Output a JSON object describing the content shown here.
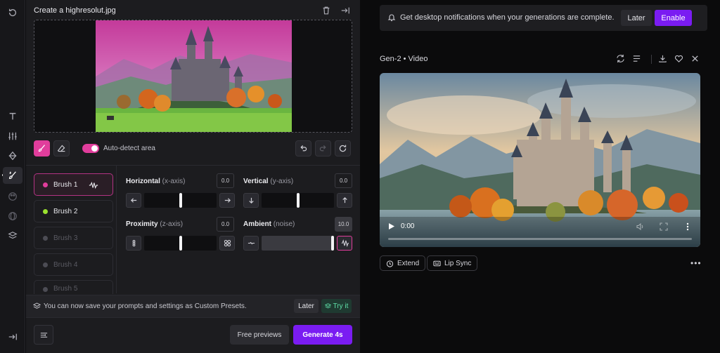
{
  "left_panel": {
    "title": "Create a highresolut.jpg",
    "auto_detect_label": "Auto-detect area",
    "brushes": [
      {
        "label": "Brush 1",
        "color": "#e13d9c",
        "selected": true
      },
      {
        "label": "Brush 2",
        "color": "#9be22f",
        "selected": false
      },
      {
        "label": "Brush 3",
        "color": "#5a5a62",
        "selected": false
      },
      {
        "label": "Brush 4",
        "color": "#5a5a62",
        "selected": false
      },
      {
        "label": "Brush 5",
        "color": "#5a5a62",
        "selected": false
      }
    ],
    "sliders": {
      "horizontal": {
        "label": "Horizontal",
        "hint": "(x-axis)",
        "value": "0.0",
        "level": 0.5
      },
      "vertical": {
        "label": "Vertical",
        "hint": "(y-axis)",
        "value": "0.0",
        "level": 0.5
      },
      "proximity": {
        "label": "Proximity",
        "hint": "(z-axis)",
        "value": "0.0",
        "level": 0.5
      },
      "ambient": {
        "label": "Ambient",
        "hint": "(noise)",
        "value": "10.0",
        "level": 1.0
      }
    },
    "notice_text": "You can now save your prompts and settings as Custom Presets.",
    "notice_later": "Later",
    "notice_try": "Try it",
    "free_previews": "Free previews",
    "generate": "Generate 4s"
  },
  "right_panel": {
    "banner_text": "Get desktop notifications when your generations are complete.",
    "banner_later": "Later",
    "banner_enable": "Enable",
    "video_title": "Gen-2 • Video",
    "video_time": "0:00",
    "extend": "Extend",
    "lip_sync": "Lip Sync"
  },
  "colors": {
    "accent_pink": "#e13d9c",
    "accent_purple": "#7a1cf2",
    "try_green": "#5fe0a8"
  }
}
